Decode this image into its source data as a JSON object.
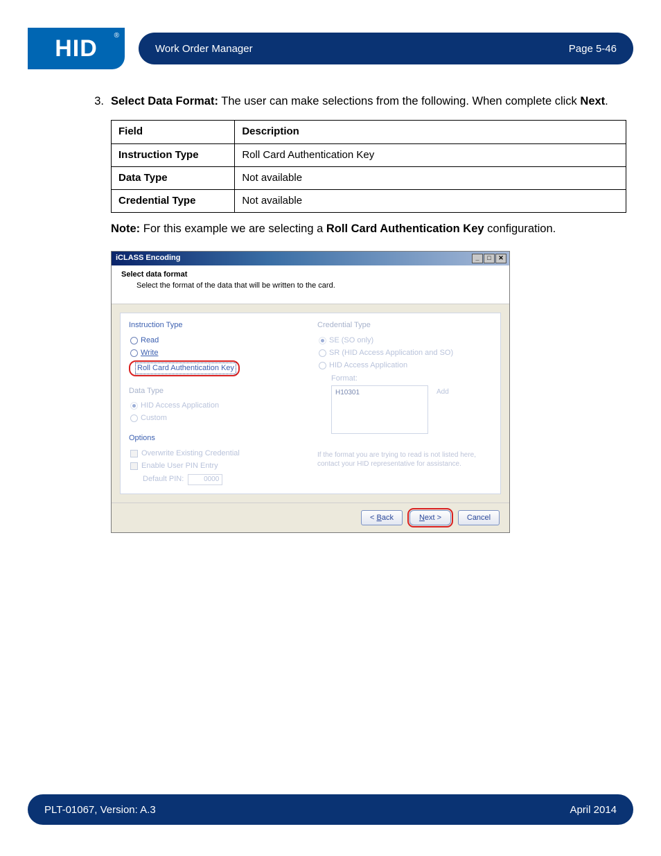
{
  "header": {
    "logo_text": "HID",
    "title": "Work Order Manager",
    "page_label": "Page 5-46"
  },
  "step": {
    "number": "3.",
    "title": "Select Data Format:",
    "body_after": " The user can make selections from the following. When complete click ",
    "body_emph": "Next",
    "body_end": "."
  },
  "table": {
    "headers": [
      "Field",
      "Description"
    ],
    "rows": [
      [
        "Instruction Type",
        "Roll Card Authentication Key"
      ],
      [
        "Data Type",
        "Not available"
      ],
      [
        "Credential Type",
        "Not available"
      ]
    ]
  },
  "note": {
    "label": "Note:",
    "before": " For this example we are selecting a ",
    "emph": "Roll Card Authentication Key",
    "after": " configuration."
  },
  "dialog": {
    "title": "iCLASS Encoding",
    "subtitle": "Select data format",
    "subdesc": "Select the format of the data that will be written to the card.",
    "left": {
      "instruction_label": "Instruction Type",
      "radio_read": "Read",
      "radio_write": "Write",
      "radio_roll": "Roll Card Authentication Key",
      "datatype_label": "Data Type",
      "datatype_hid": "HID Access Application",
      "datatype_custom": "Custom",
      "options_label": "Options",
      "opt_overwrite": "Overwrite Existing Credential",
      "opt_pin": "Enable User PIN Entry",
      "default_pin_label": "Default PIN:",
      "default_pin_value": "0000"
    },
    "right": {
      "credential_label": "Credential Type",
      "radio_se": "SE (SO only)",
      "radio_sr": "SR (HID Access Application and SO)",
      "radio_hid": "HID Access Application",
      "format_label": "Format:",
      "format_item": "H10301",
      "add_link": "Add",
      "help_text": "If the format you are trying to read is not listed here, contact your HID representative for assistance."
    },
    "buttons": {
      "back": "Back",
      "next": "Next >",
      "cancel": "Cancel"
    }
  },
  "footer": {
    "left": "PLT-01067, Version: A.3",
    "right": "April 2014"
  }
}
